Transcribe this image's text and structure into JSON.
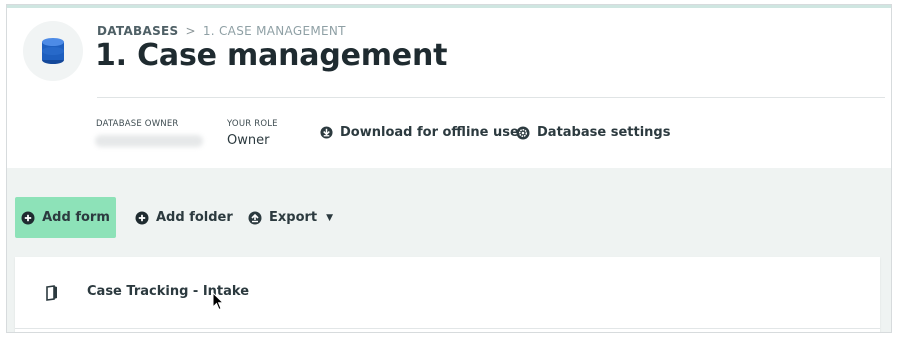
{
  "breadcrumb": {
    "root": "DATABASES",
    "separator": ">",
    "current": "1. CASE MANAGEMENT"
  },
  "page": {
    "title": "1. Case management"
  },
  "meta": {
    "owner_label": "DATABASE OWNER",
    "role_label": "YOUR ROLE",
    "role_value": "Owner"
  },
  "actions": {
    "download": "Download for offline use",
    "settings": "Database settings"
  },
  "toolbar": {
    "add_form": "Add form",
    "add_folder": "Add folder",
    "export": "Export"
  },
  "forms": [
    {
      "name": "Case Tracking - Intake",
      "icon": "form-icon"
    }
  ],
  "colors": {
    "primary_button": "#8de2b8",
    "workspace_bg": "#eff3f2",
    "db_icon_blue": "#1e5fbf"
  }
}
